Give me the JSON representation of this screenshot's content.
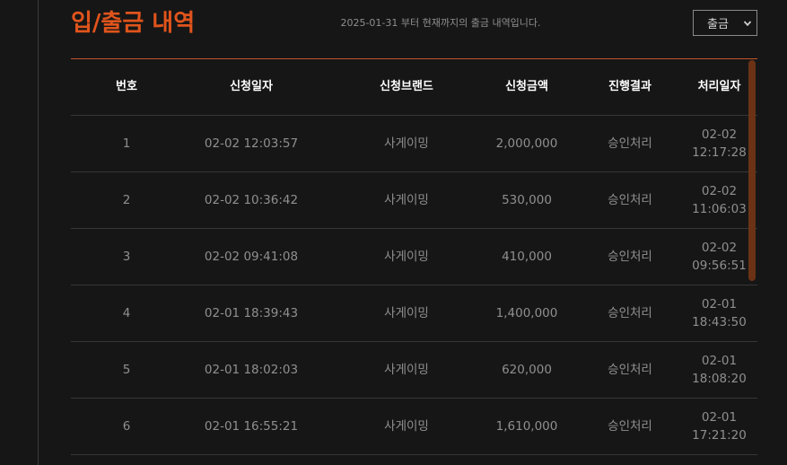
{
  "header": {
    "title": "입/출금 내역",
    "notice": "2025-01-31 부터 현재까지의 출금 내역입니다.",
    "type_select": {
      "value": "출금"
    }
  },
  "table": {
    "columns": {
      "no": "번호",
      "date": "신청일자",
      "brand": "신청브랜드",
      "amount": "신청금액",
      "result": "진행결과",
      "processed": "처리일자"
    },
    "rows": [
      {
        "no": "1",
        "date": "02-02 12:03:57",
        "brand": "사게이밍",
        "amount": "2,000,000",
        "result": "승인처리",
        "processed_date": "02-02",
        "processed_time": "12:17:28"
      },
      {
        "no": "2",
        "date": "02-02 10:36:42",
        "brand": "사게이밍",
        "amount": "530,000",
        "result": "승인처리",
        "processed_date": "02-02",
        "processed_time": "11:06:03"
      },
      {
        "no": "3",
        "date": "02-02 09:41:08",
        "brand": "사게이밍",
        "amount": "410,000",
        "result": "승인처리",
        "processed_date": "02-02",
        "processed_time": "09:56:51"
      },
      {
        "no": "4",
        "date": "02-01 18:39:43",
        "brand": "사게이밍",
        "amount": "1,400,000",
        "result": "승인처리",
        "processed_date": "02-01",
        "processed_time": "18:43:50"
      },
      {
        "no": "5",
        "date": "02-01 18:02:03",
        "brand": "사게이밍",
        "amount": "620,000",
        "result": "승인처리",
        "processed_date": "02-01",
        "processed_time": "18:08:20"
      },
      {
        "no": "6",
        "date": "02-01 16:55:21",
        "brand": "사게이밍",
        "amount": "1,610,000",
        "result": "승인처리",
        "processed_date": "02-01",
        "processed_time": "17:21:20"
      }
    ]
  },
  "colors": {
    "accent": "#e0541c",
    "background": "#161616",
    "scrollbar": "#6b3215"
  },
  "icons": {
    "select_caret": "chevron-down-icon"
  }
}
